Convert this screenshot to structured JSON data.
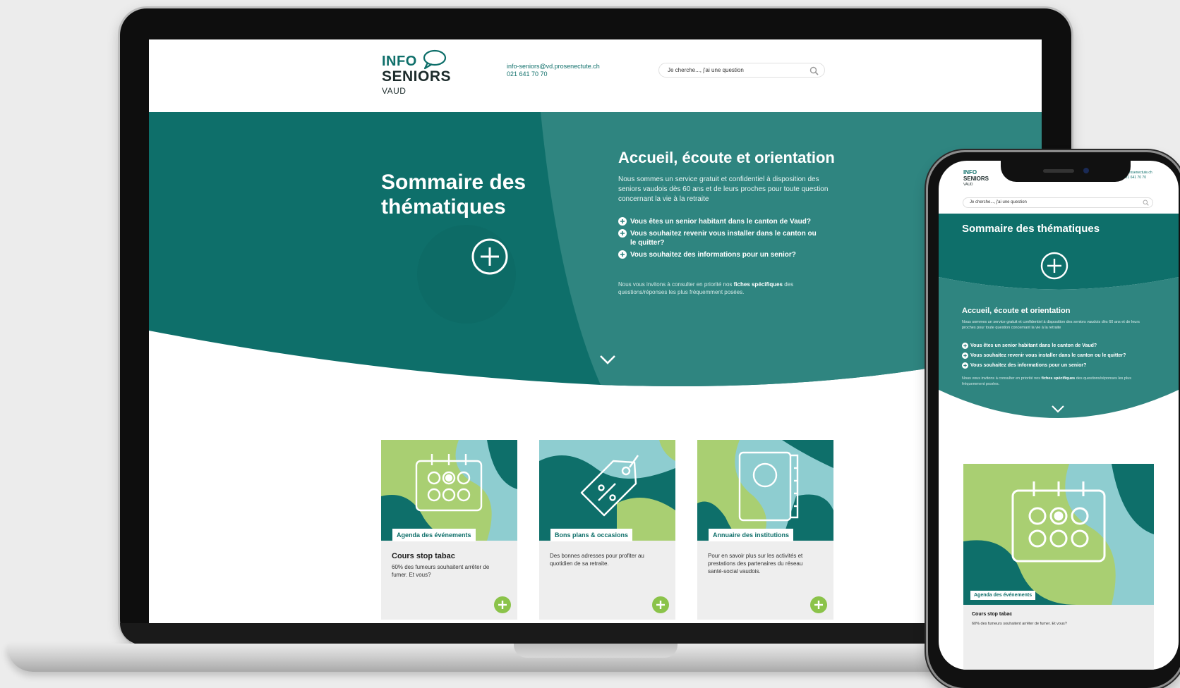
{
  "site": {
    "logo": {
      "line1": "INFO",
      "line2": "SENIORS",
      "line3": "VAUD"
    },
    "contact": {
      "email": "info-seniors@vd.prosenectute.ch",
      "phone": "021 641 70 70"
    },
    "search": {
      "placeholder": "Je cherche..., j'ai une question"
    }
  },
  "hero": {
    "left_title": "Sommaire des thématiques",
    "right_title": "Accueil, écoute et orientation",
    "intro": "Nous sommes un service gratuit et confidentiel à disposition des seniors vaudois dès 60 ans et de leurs proches pour toute question concernant la vie à la retraite",
    "questions": [
      "Vous êtes un senior habitant dans le canton de Vaud?",
      "Vous souhaitez revenir vous installer dans le canton ou le quitter?",
      "Vous souhaitez des informations pour un senior?"
    ],
    "note_before": "Nous vous invitons à consulter en priorité nos ",
    "note_bold": "fiches spécifiques",
    "note_after": " des questions/réponses les plus fréquemment posées."
  },
  "cards": [
    {
      "tag": "Agenda des événements",
      "title": "Cours stop tabac",
      "desc": "60% des fumeurs souhaitent arrêter de fumer. Et vous?"
    },
    {
      "tag": "Bons plans & occasions",
      "title": "",
      "desc": "Des bonnes adresses pour profiter au quotidien de sa retraite."
    },
    {
      "tag": "Annuaire des institutions",
      "title": "",
      "desc": "Pour en savoir plus sur les activités et prestations des partenaires du réseau santé-social vaudois."
    }
  ],
  "mobile": {
    "logo": {
      "line1": "INFO",
      "line2": "SENIORS",
      "line3": "VAUD"
    },
    "contact": {
      "email": "@prosenectute.ch",
      "phone": "021 641 70 70"
    },
    "search_placeholder": "Je cherche..., j'ai une question",
    "title": "Sommaire des thématiques",
    "subtitle": "Accueil, écoute et orientation",
    "intro": "Nous sommes un service gratuit et confidentiel à disposition des seniors vaudois dès 60 ans et de leurs proches pour toute question concernant la vie à la retraite",
    "questions": [
      "Vous êtes un senior habitant dans le canton de Vaud?",
      "Vous souhaitez revenir vous installer dans le canton ou le quitter?",
      "Vous souhaitez des informations pour un senior?"
    ],
    "note_before": "Nous vous invitons à consulter en priorité nos ",
    "note_bold": "fiches spécifiques",
    "note_after": " des questions/réponses les plus fréquemment posées.",
    "card": {
      "tag": "Agenda des événements",
      "title": "Cours stop tabac",
      "desc": "60% des fumeurs souhaitent arrêter de fumer. Et vous?"
    }
  },
  "colors": {
    "teal": "#0e6f6a",
    "teal_light": "#2f8580",
    "lime": "#a9cf72",
    "sky": "#8ecdd0",
    "card_bg": "#eeeeee"
  },
  "icons": [
    "speech-bubble-icon",
    "search-icon",
    "plus-circle-icon",
    "chevron-down-icon",
    "calendar-icon",
    "price-tag-icon",
    "address-book-icon"
  ]
}
